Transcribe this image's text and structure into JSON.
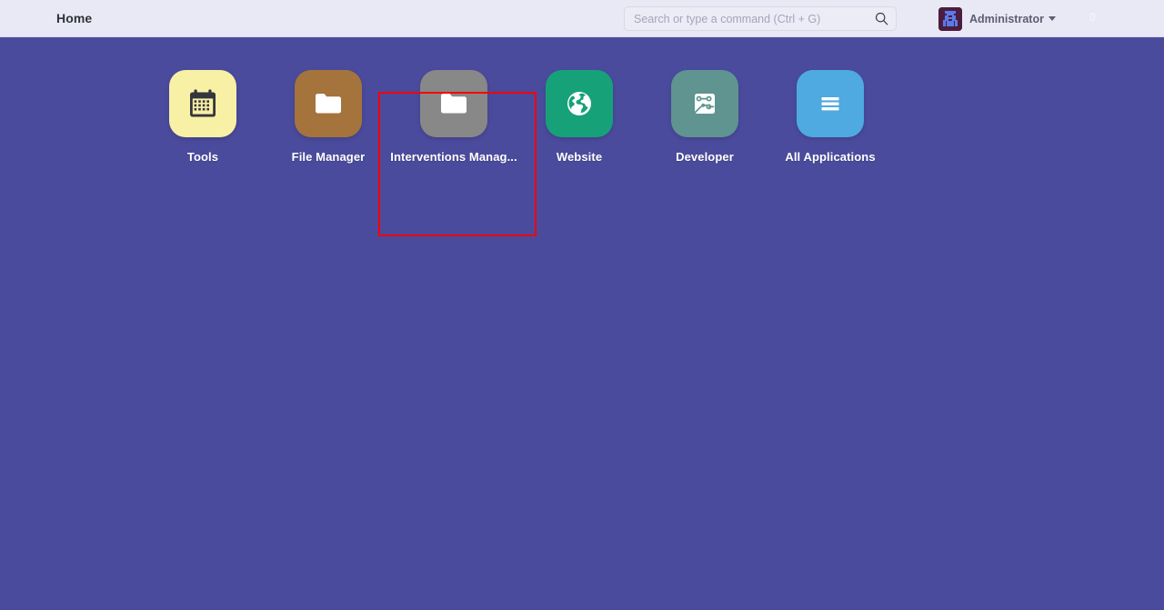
{
  "navbar": {
    "brand_label": "Home",
    "search": {
      "placeholder": "Search or type a command (Ctrl + G)",
      "value": "",
      "icon": "search-icon"
    },
    "user": {
      "name": "Administrator",
      "avatar_icon": "user-avatar-robot",
      "caret_icon": "chevron-down-icon"
    },
    "notification_count": "0",
    "colors": {
      "background": "#e9e9f5",
      "text": "#2e3338",
      "muted_text": "#5d5d72",
      "avatar_background": "#4b1d3f",
      "avatar_figure": "#5b7ae8"
    }
  },
  "desktop": {
    "background": "#4b4b9d",
    "apps": [
      {
        "label": "Tools",
        "icon": "calendar-icon",
        "tile_color": "#f8f0a4",
        "icon_color": "#33363d"
      },
      {
        "label": "File Manager",
        "icon": "folder-icon",
        "tile_color": "#a5733c",
        "icon_color": "#ffffff"
      },
      {
        "label": "Interventions Manag...",
        "icon": "folder-icon",
        "tile_color": "#888888",
        "icon_color": "#ffffff"
      },
      {
        "label": "Website",
        "icon": "globe-icon",
        "tile_color": "#17a179",
        "icon_color": "#ffffff"
      },
      {
        "label": "Developer",
        "icon": "circuit-board-icon",
        "tile_color": "#5f9490",
        "icon_color": "#ffffff"
      },
      {
        "label": "All Applications",
        "icon": "hamburger-list-icon",
        "tile_color": "#4eaae0",
        "icon_color": "#ffffff"
      }
    ],
    "highlight": {
      "target_label": "Interventions Manag...",
      "color": "#f60000"
    }
  }
}
